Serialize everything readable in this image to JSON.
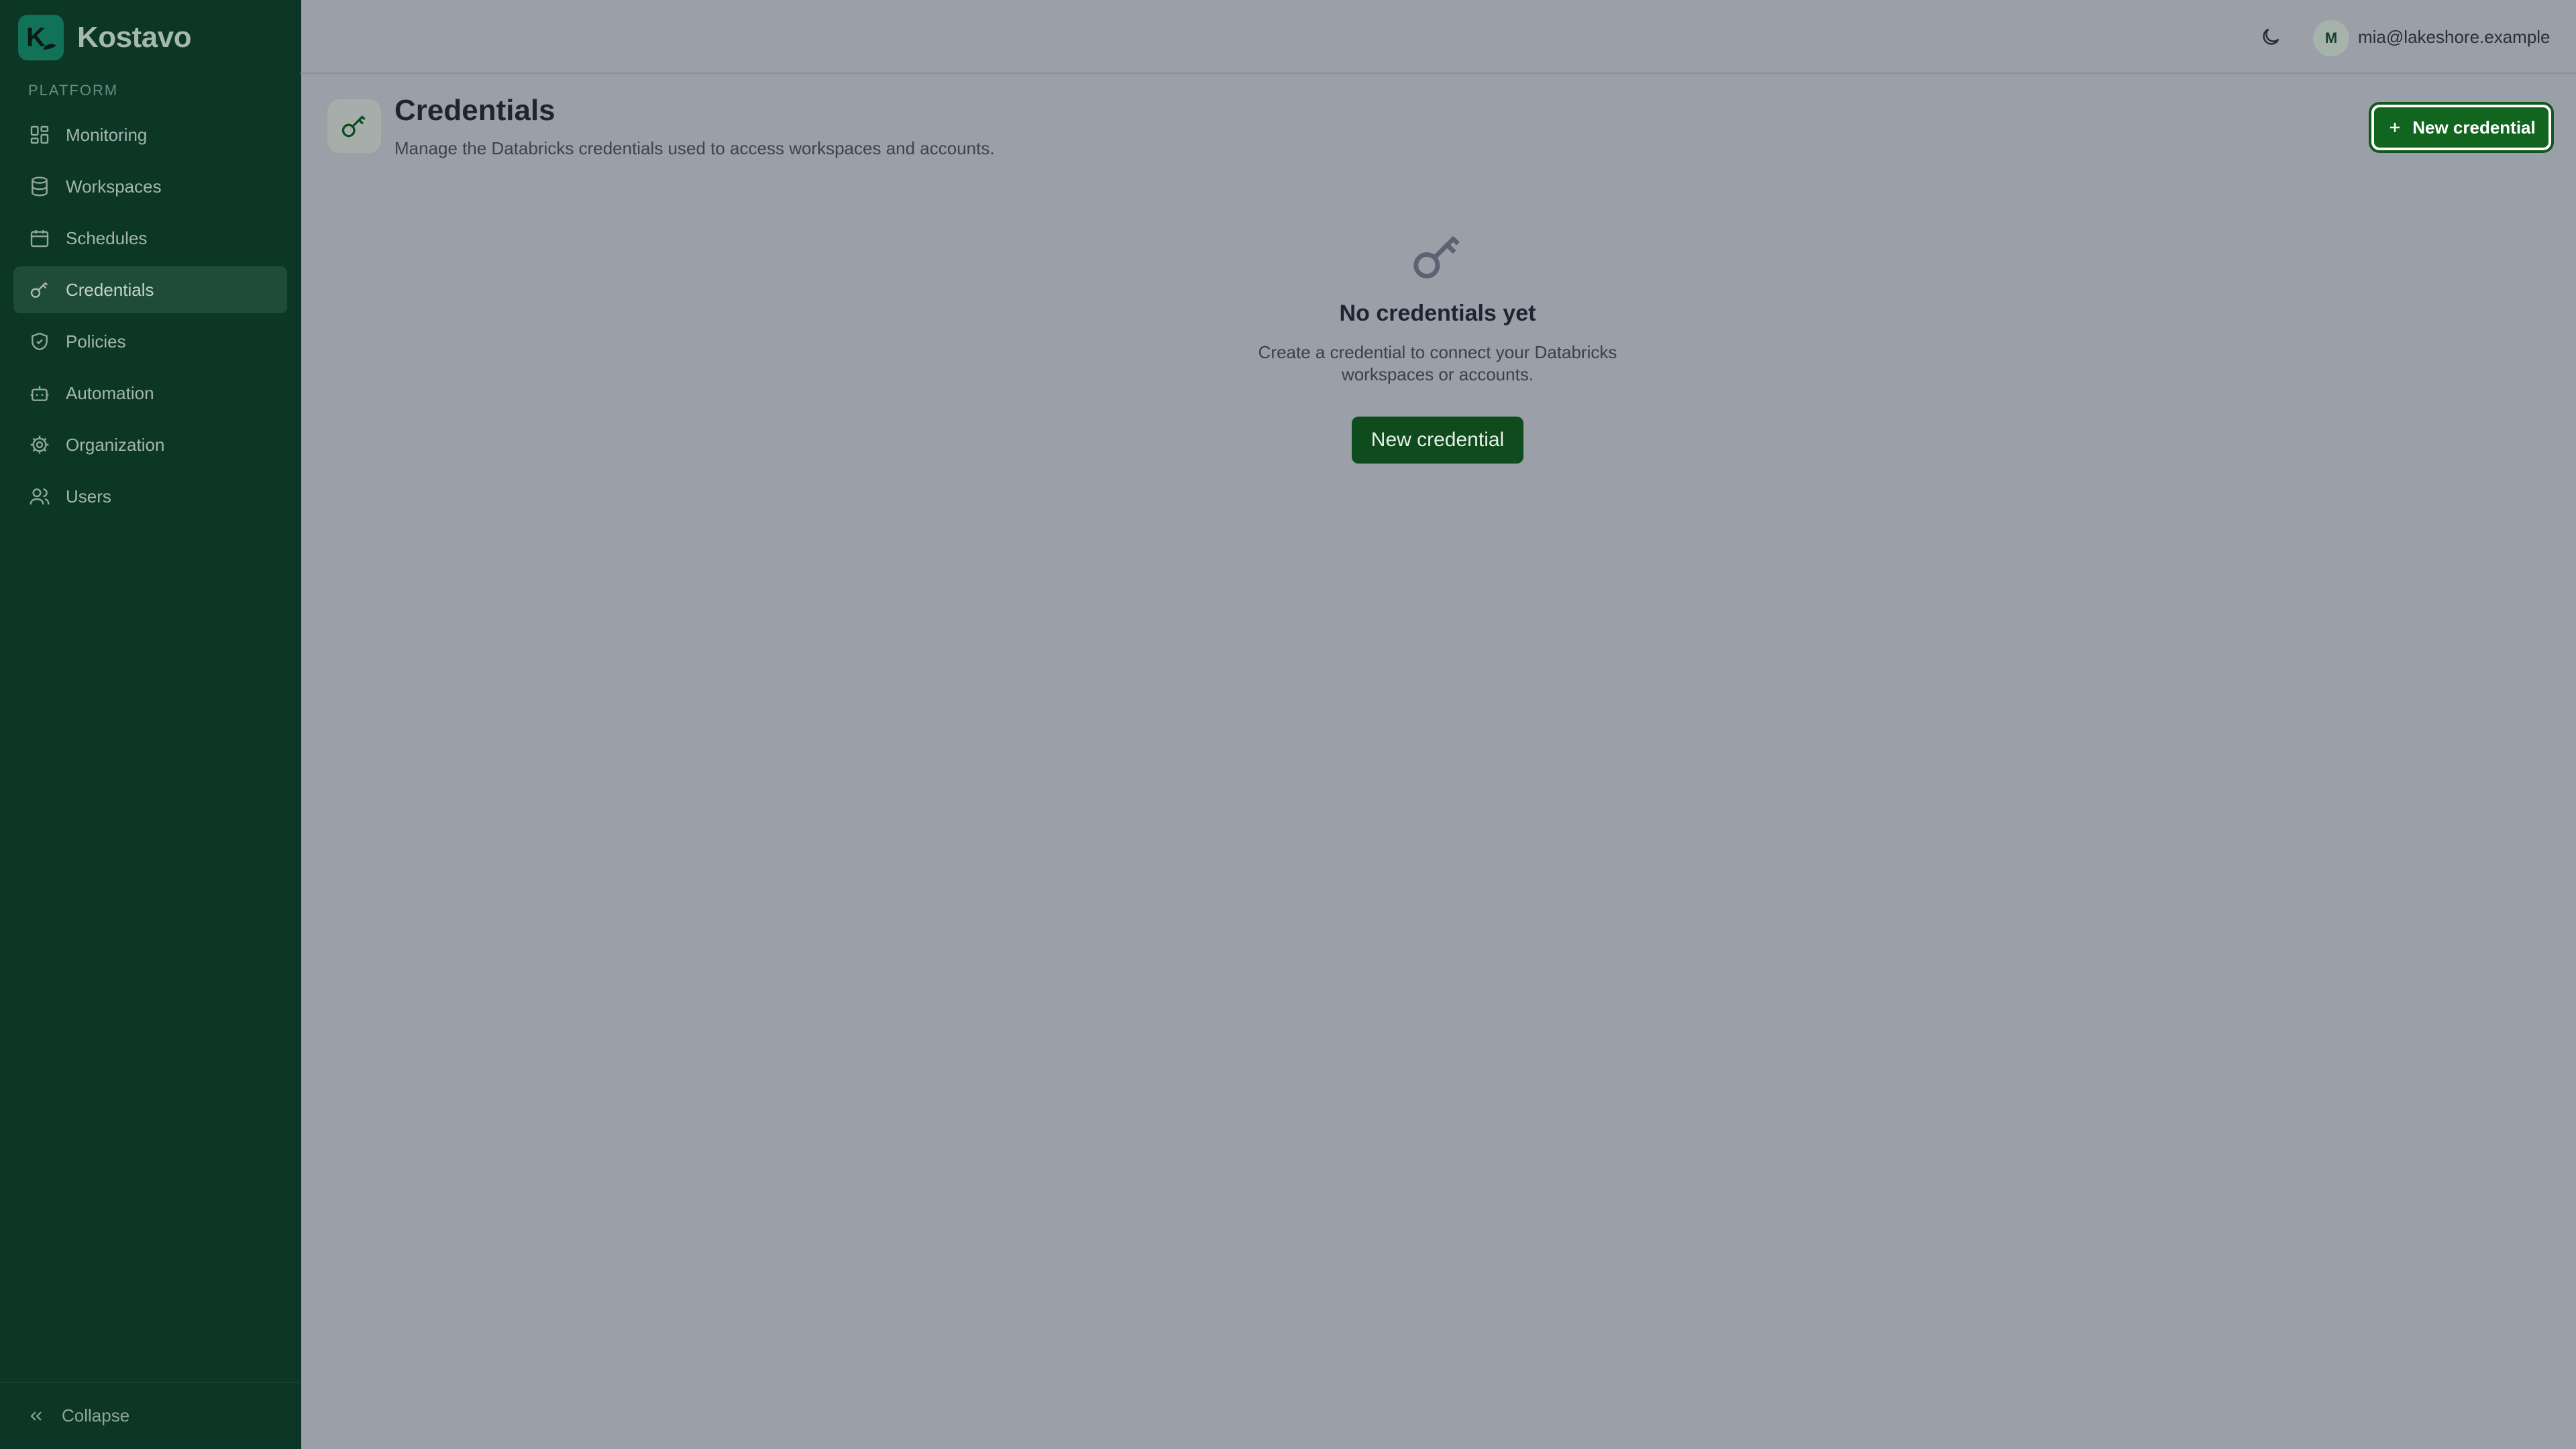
{
  "app": {
    "name": "Kostavo",
    "logo_letter": "K"
  },
  "sidebar": {
    "section_label": "PLATFORM",
    "items": [
      {
        "label": "Monitoring",
        "icon": "dashboard-grid-icon"
      },
      {
        "label": "Workspaces",
        "icon": "database-icon"
      },
      {
        "label": "Schedules",
        "icon": "calendar-icon"
      },
      {
        "label": "Credentials",
        "icon": "key-icon",
        "active": true
      },
      {
        "label": "Policies",
        "icon": "shield-icon"
      },
      {
        "label": "Automation",
        "icon": "bot-icon"
      },
      {
        "label": "Organization",
        "icon": "gear-icon"
      },
      {
        "label": "Users",
        "icon": "users-icon"
      }
    ],
    "collapse_label": "Collapse"
  },
  "topbar": {
    "avatar_initial": "M",
    "user_email": "mia@lakeshore.example"
  },
  "page": {
    "title": "Credentials",
    "subtitle": "Manage the Databricks credentials used to access workspaces and accounts.",
    "new_button_label": "New credential"
  },
  "empty_state": {
    "title": "No credentials yet",
    "description": "Create a credential to connect your Databricks workspaces or accounts.",
    "button_label": "New credential"
  },
  "colors": {
    "sidebar_bg": "#0c3726",
    "main_bg": "#9a9fa8",
    "primary": "#12651f"
  }
}
